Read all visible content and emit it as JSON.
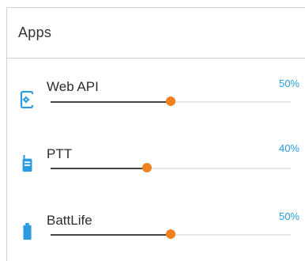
{
  "panel": {
    "title": "Apps"
  },
  "apps": [
    {
      "label": "Web API",
      "percent_text": "50%",
      "value": 0.5,
      "icon": "webapi-phone-gear-icon"
    },
    {
      "label": "PTT",
      "percent_text": "40%",
      "value": 0.4,
      "icon": "walkie-talkie-icon"
    },
    {
      "label": "BattLife",
      "percent_text": "50%",
      "value": 0.5,
      "icon": "battery-icon"
    }
  ],
  "colors": {
    "accent_blue": "#2a9be0",
    "thumb_orange": "#f08020",
    "track_fill": "#444444",
    "track_empty": "#e6e6e6"
  }
}
